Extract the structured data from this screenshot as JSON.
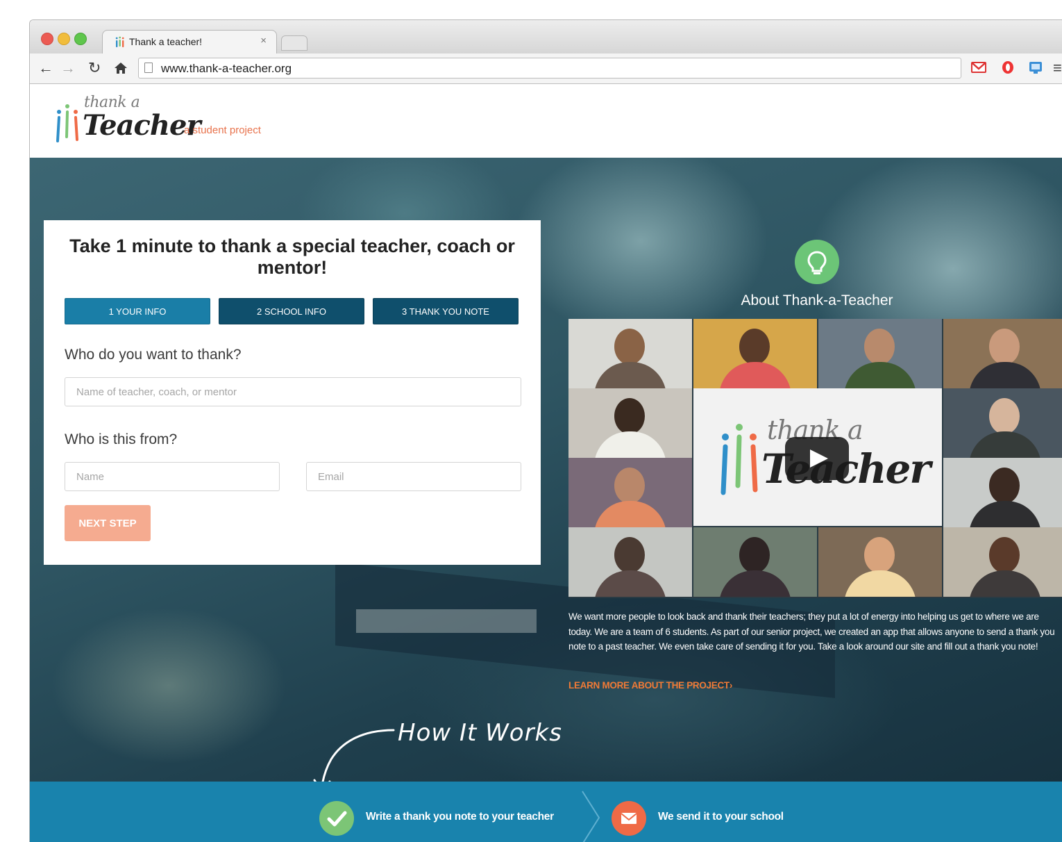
{
  "browser": {
    "tab_title": "Thank a teacher!",
    "tab_close": "×",
    "url": "www.thank-a-teacher.org",
    "menu_glyph": "≡"
  },
  "site": {
    "logo_small": "thank a",
    "logo_large": "Teacher",
    "tagline": "a student project",
    "brand_colors": {
      "orange": "#e8734d",
      "blue": "#1983ad",
      "green": "#7cc576"
    }
  },
  "form": {
    "title": "Take 1 minute to thank a special teacher, coach or mentor!",
    "steps": [
      "1 YOUR INFO",
      "2 SCHOOL INFO",
      "3 THANK YOU NOTE"
    ],
    "active_step": 0,
    "question_who": "Who do you want to thank?",
    "teacher_placeholder": "Name of teacher, coach, or mentor",
    "question_from": "Who is this from?",
    "name_placeholder": "Name",
    "email_placeholder": "Email",
    "next_label": "NEXT STEP"
  },
  "about": {
    "icon": "lightbulb-icon",
    "title": "About Thank-a-Teacher",
    "video_logo_small": "thank a",
    "video_logo_large": "Teacher",
    "text": "We want more people to look back and thank their teachers; they put a lot of energy into helping us get to where we are today. We are a team of 6 students. As part of our senior project, we created an app that allows anyone to send a thank you note to a past teacher. We even take care of sending it for you. Take a look around our site and fill out a thank you note!",
    "learn_more": "LEARN MORE ABOUT THE PROJECT›"
  },
  "how_it_works": {
    "label": "How It Works",
    "steps": [
      {
        "icon": "check-icon",
        "label": "Write a thank you note to your teacher"
      },
      {
        "icon": "envelope-icon",
        "label": "We send it to your school"
      }
    ]
  }
}
